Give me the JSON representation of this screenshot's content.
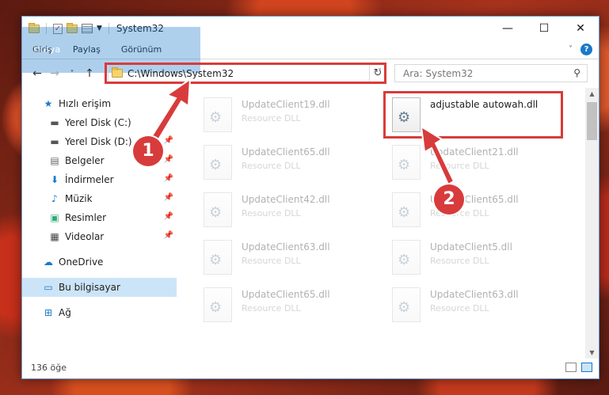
{
  "window": {
    "title": "System32"
  },
  "window_buttons": {
    "minimize": "—",
    "maximize": "☐",
    "close": "✕"
  },
  "ribbon": {
    "tabs": [
      "Dosya",
      "Giriş",
      "Paylaş",
      "Görünüm"
    ],
    "help": "?"
  },
  "nav": {
    "back": "←",
    "forward": "→",
    "recent": "˅",
    "up": "↑"
  },
  "address": {
    "path": "C:\\Windows\\System32",
    "refresh": "↻"
  },
  "search": {
    "placeholder": "Ara: System32",
    "icon": "⚲"
  },
  "sidebar": {
    "quick_access": "Hızlı erişim",
    "items": [
      {
        "label": "Yerel Disk (C:)",
        "icon": "drive-icon"
      },
      {
        "label": "Yerel Disk (D:)",
        "icon": "drive-icon"
      },
      {
        "label": "Belgeler",
        "icon": "documents-icon"
      },
      {
        "label": "İndirmeler",
        "icon": "downloads-icon"
      },
      {
        "label": "Müzik",
        "icon": "music-icon"
      },
      {
        "label": "Resimler",
        "icon": "pictures-icon"
      },
      {
        "label": "Videolar",
        "icon": "videos-icon"
      }
    ],
    "onedrive": "OneDrive",
    "this_pc": "Bu bilgisayar",
    "network": "Ağ"
  },
  "files": [
    {
      "name": "UpdateClient19.dll",
      "type": "Resource DLL"
    },
    {
      "name": "adjustable autowah.dll",
      "type": ""
    },
    {
      "name": "UpdateClient65.dll",
      "type": "Resource DLL"
    },
    {
      "name": "UpdateClient21.dll",
      "type": "Resource DLL"
    },
    {
      "name": "UpdateClient42.dll",
      "type": "Resource DLL"
    },
    {
      "name": "UpdateClient65.dll",
      "type": "Resource DLL"
    },
    {
      "name": "UpdateClient63.dll",
      "type": "Resource DLL"
    },
    {
      "name": "UpdateClient5.dll",
      "type": "Resource DLL"
    },
    {
      "name": "UpdateClient65.dll",
      "type": "Resource DLL"
    },
    {
      "name": "UpdateClient63.dll",
      "type": "Resource DLL"
    }
  ],
  "status": {
    "count": "136 öğe"
  },
  "annotations": {
    "step1": "1",
    "step2": "2",
    "color": "#d83b3b"
  }
}
